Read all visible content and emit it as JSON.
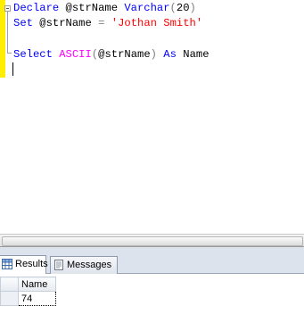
{
  "editor": {
    "lines": [
      [
        {
          "t": "Declare",
          "c": "kw"
        },
        {
          "t": " @strName ",
          "c": ""
        },
        {
          "t": "Varchar",
          "c": "kw"
        },
        {
          "t": "(",
          "c": "op"
        },
        {
          "t": "20",
          "c": ""
        },
        {
          "t": ")",
          "c": "op"
        }
      ],
      [
        {
          "t": "Set",
          "c": "kw"
        },
        {
          "t": " @strName ",
          "c": ""
        },
        {
          "t": "=",
          "c": "op"
        },
        {
          "t": " ",
          "c": ""
        },
        {
          "t": "'Jothan Smith'",
          "c": "str"
        }
      ],
      [
        {
          "t": "Select",
          "c": "kw"
        },
        {
          "t": " ",
          "c": ""
        },
        {
          "t": "ASCII",
          "c": "fn"
        },
        {
          "t": "(",
          "c": "op"
        },
        {
          "t": "@strName",
          "c": ""
        },
        {
          "t": ")",
          "c": "op"
        },
        {
          "t": " ",
          "c": ""
        },
        {
          "t": "As",
          "c": "kw"
        },
        {
          "t": " Name",
          "c": ""
        }
      ]
    ],
    "colors": {
      "keyword": "#0000ff",
      "function": "#ff00ff",
      "string": "#ff0000",
      "operator": "#808080",
      "change_margin": "#ffee00"
    }
  },
  "tabs": {
    "results_label": "Results",
    "messages_label": "Messages",
    "results_icon": "grid-icon",
    "messages_icon": "messages-icon"
  },
  "grid": {
    "columns": [
      "Name"
    ],
    "rows": [
      [
        "74"
      ]
    ]
  }
}
